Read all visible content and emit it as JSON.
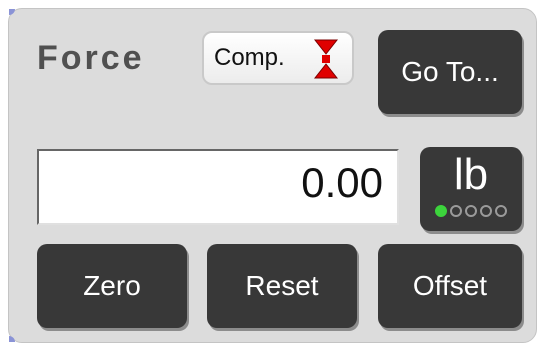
{
  "panel": {
    "title": "Force",
    "mode": {
      "label": "Comp.",
      "icon": "compression-arrows-icon"
    },
    "goto_label": "Go To...",
    "reading": "0.00",
    "unit": {
      "label": "lb",
      "dots_total": 5,
      "dot_active_index": 0
    },
    "buttons": {
      "zero": "Zero",
      "reset": "Reset",
      "offset": "Offset"
    },
    "colors": {
      "panel_bg": "#dcdcdc",
      "button_bg": "#383838",
      "arrow_red": "#e00000",
      "indicator_green": "#3cd43c"
    }
  }
}
